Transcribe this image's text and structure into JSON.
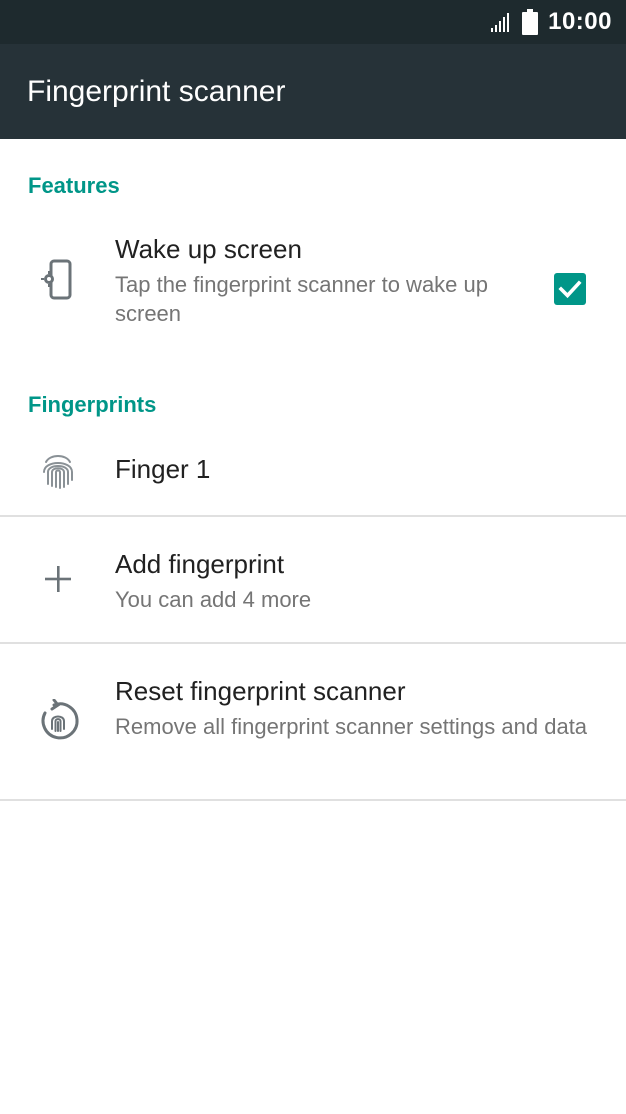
{
  "status_bar": {
    "time": "10:00",
    "icons": [
      "signal-icon",
      "battery-icon"
    ]
  },
  "app_bar": {
    "title": "Fingerprint scanner"
  },
  "sections": {
    "features": {
      "header": "Features",
      "wake_up": {
        "title": "Wake up screen",
        "subtitle": "Tap the fingerprint scanner to wake up screen",
        "icon": "phone-settings-icon",
        "checked": true
      }
    },
    "fingerprints": {
      "header": "Fingerprints",
      "finger_1": {
        "title": "Finger 1",
        "icon": "fingerprint-icon"
      },
      "add": {
        "title": "Add fingerprint",
        "subtitle": "You can add 4 more",
        "icon": "plus-icon"
      },
      "reset": {
        "title": "Reset fingerprint scanner",
        "subtitle": "Remove all fingerprint scanner settings and data",
        "icon": "reset-fingerprint-icon"
      }
    }
  },
  "colors": {
    "accent": "#009688",
    "app_bar": "#263238",
    "status_bar": "#1e2a2e"
  }
}
